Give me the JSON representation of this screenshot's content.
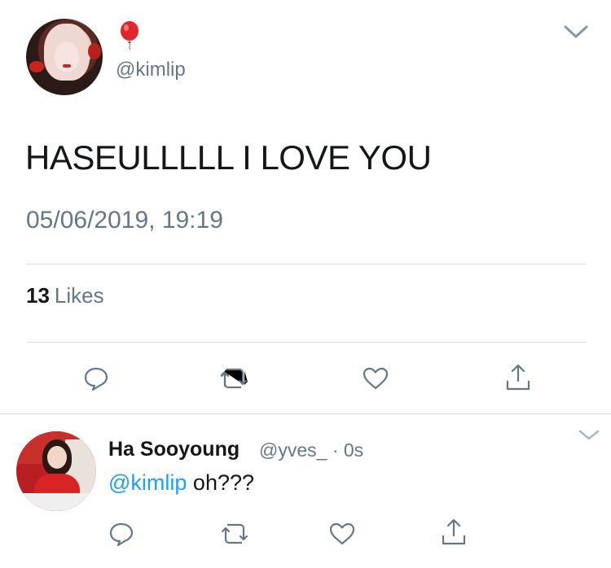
{
  "main_tweet": {
    "display_name": "🎈",
    "handle": "@kimlip",
    "text": "HASEULLLLL I LOVE YOU",
    "timestamp": "05/06/2019, 19:19",
    "likes_count": "13",
    "likes_label": "Likes",
    "actions": [
      "reply-icon",
      "retweet-icon",
      "like-icon",
      "share-icon"
    ]
  },
  "reply": {
    "display_name": "Ha Sooyoung",
    "handle": "@yves_",
    "separator": "·",
    "time": "0s",
    "mention": "@kimlip",
    "text": " oh???",
    "actions": [
      "reply-icon",
      "retweet-icon",
      "like-icon",
      "share-icon"
    ]
  },
  "colors": {
    "text": "#14171a",
    "secondary": "#657786",
    "link": "#1da1f2",
    "divider": "#d7dde2"
  }
}
